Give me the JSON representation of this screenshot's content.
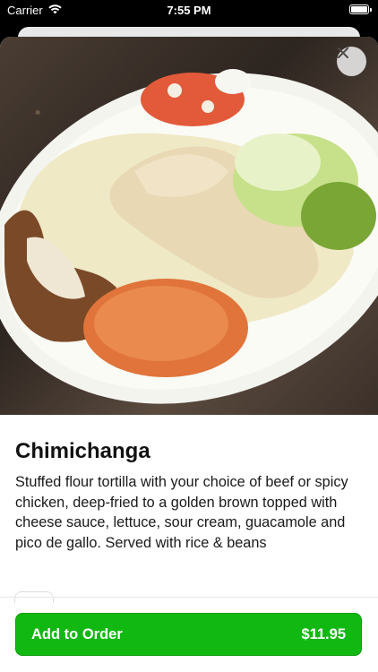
{
  "status_bar": {
    "carrier": "Carrier",
    "time": "7:55 PM"
  },
  "item": {
    "name": "Chimichanga",
    "description": "Stuffed flour tortilla with your choice of beef or spicy chicken, deep-fried to a golden brown topped with cheese sauce, lettuce, sour cream, guacamole and pico de gallo. Served with rice & beans"
  },
  "order_button": {
    "label": "Add to Order",
    "price": "$11.95"
  },
  "colors": {
    "accent_green": "#12b812"
  }
}
